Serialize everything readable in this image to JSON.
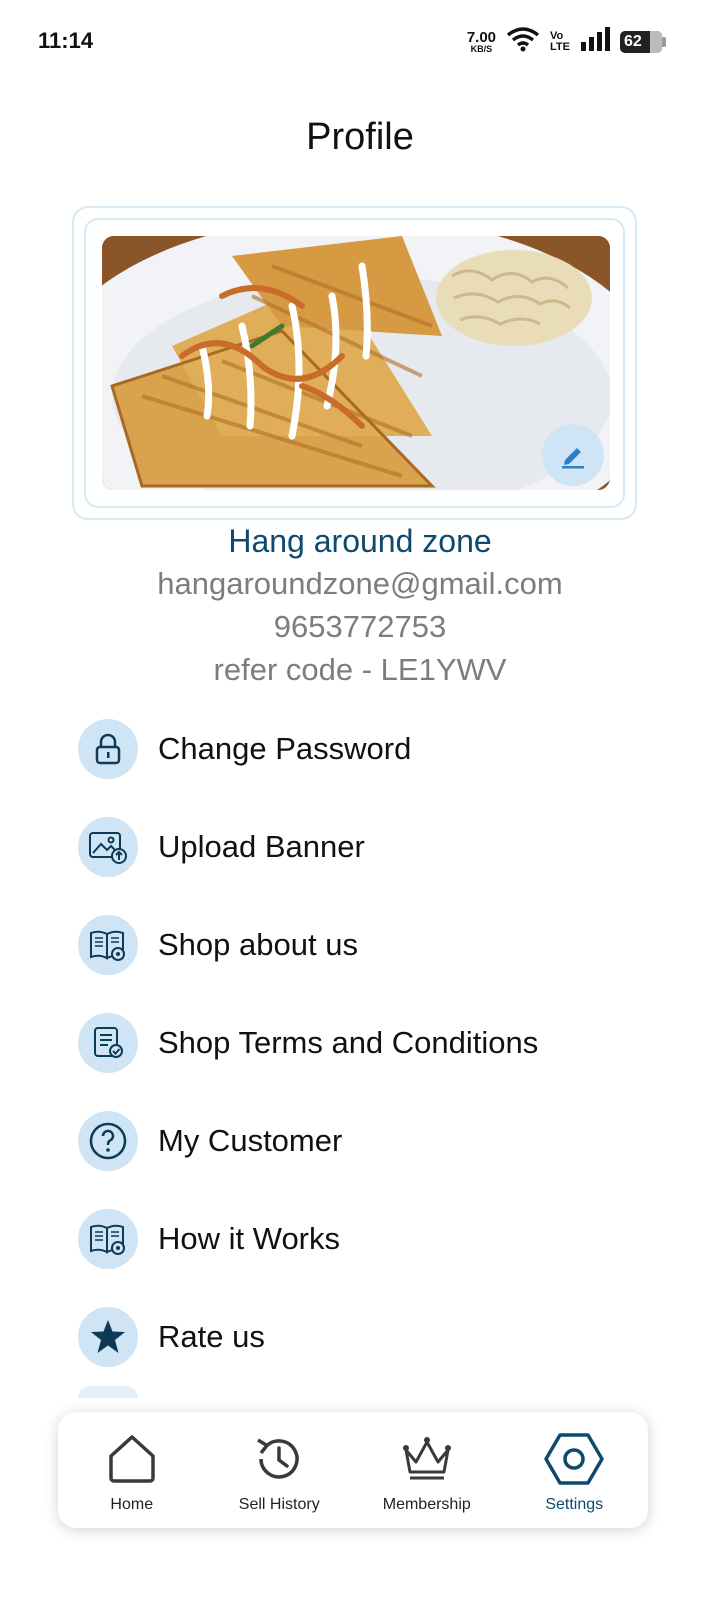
{
  "status_bar": {
    "time": "11:14",
    "net_speed_value": "7.00",
    "net_speed_unit": "KB/S",
    "volte_top": "Vo",
    "volte_bottom": "LTE",
    "battery": "62"
  },
  "header": {
    "title": "Profile"
  },
  "banner": {
    "image": "food-banner-image",
    "edit_icon": "pencil-icon"
  },
  "profile": {
    "shop_name": "Hang around zone",
    "email": "hangaroundzone@gmail.com",
    "phone": "9653772753",
    "refer_code": "refer code - LE1YWV"
  },
  "menu": [
    {
      "label": "Change Password",
      "icon": "lock-icon"
    },
    {
      "label": "Upload Banner",
      "icon": "image-upload-icon"
    },
    {
      "label": "Shop about us",
      "icon": "book-gear-icon"
    },
    {
      "label": "Shop Terms and Conditions",
      "icon": "document-check-icon"
    },
    {
      "label": "My Customer",
      "icon": "question-circle-icon"
    },
    {
      "label": "How it Works",
      "icon": "book-gear-icon"
    },
    {
      "label": "Rate us",
      "icon": "star-icon"
    }
  ],
  "bottom_nav": [
    {
      "label": "Home",
      "icon": "home-icon",
      "active": false
    },
    {
      "label": "Sell History",
      "icon": "history-icon",
      "active": false
    },
    {
      "label": "Membership",
      "icon": "crown-icon",
      "active": false
    },
    {
      "label": "Settings",
      "icon": "settings-icon",
      "active": true
    }
  ],
  "colors": {
    "accent": "#0d4a6e",
    "icon_bg": "#cfe5f5",
    "muted_text": "#7d7d7d",
    "border": "#d6e9f7"
  }
}
